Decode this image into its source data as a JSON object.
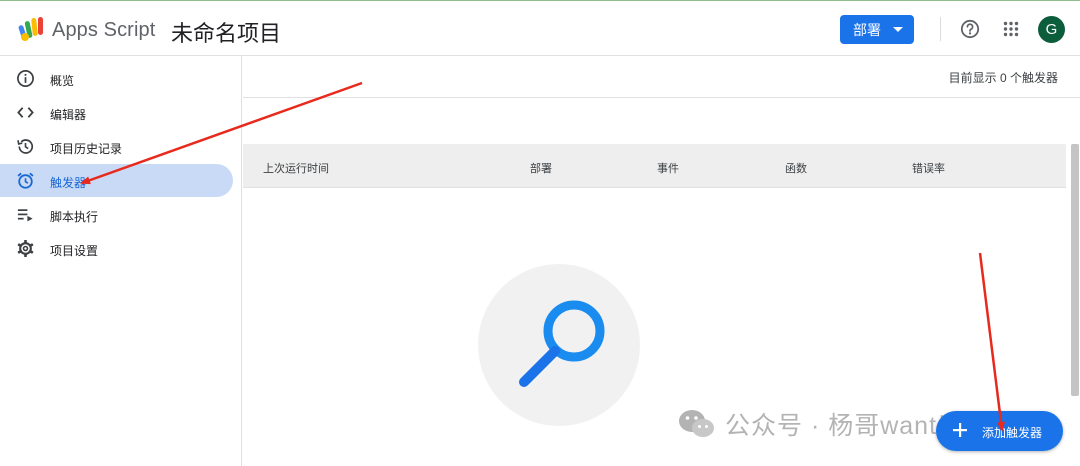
{
  "header": {
    "app_name": "Apps Script",
    "project_title": "未命名项目",
    "deploy_label": "部署",
    "avatar_letter": "G"
  },
  "sidebar": {
    "items": [
      {
        "label": "概览",
        "icon": "info-icon"
      },
      {
        "label": "编辑器",
        "icon": "code-icon"
      },
      {
        "label": "项目历史记录",
        "icon": "history-icon"
      },
      {
        "label": "触发器",
        "icon": "alarm-clock-icon",
        "active": true
      },
      {
        "label": "脚本执行",
        "icon": "list-play-icon"
      },
      {
        "label": "项目设置",
        "icon": "gear-icon"
      }
    ]
  },
  "main": {
    "trigger_count_text": "目前显示 0 个触发器",
    "columns": [
      "上次运行时间",
      "部署",
      "事件",
      "函数",
      "错误率"
    ],
    "add_trigger_label": "添加触发器"
  },
  "watermark": {
    "text": "公众号 · 杨哥want出海"
  },
  "colors": {
    "accent": "#1a73e8",
    "active_nav_bg": "#c9daf6",
    "avatar_bg": "#0b5d3b",
    "annotation_arrow": "#e8291c"
  }
}
